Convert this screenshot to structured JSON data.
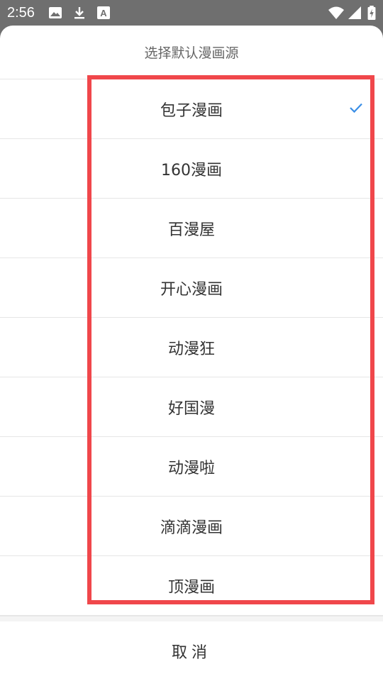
{
  "status_bar": {
    "time": "2:56",
    "left_icons": [
      "image-icon",
      "download-icon",
      "font-icon"
    ],
    "right_icons": [
      "wifi-icon",
      "signal-icon",
      "battery-charging-icon"
    ]
  },
  "dialog": {
    "title": "选择默认漫画源",
    "options": [
      {
        "label": "包子漫画",
        "selected": true
      },
      {
        "label": "160漫画",
        "selected": false
      },
      {
        "label": "百漫屋",
        "selected": false
      },
      {
        "label": "开心漫画",
        "selected": false
      },
      {
        "label": "动漫狂",
        "selected": false
      },
      {
        "label": "好国漫",
        "selected": false
      },
      {
        "label": "动漫啦",
        "selected": false
      },
      {
        "label": "滴滴漫画",
        "selected": false
      },
      {
        "label": "顶漫画",
        "selected": false
      }
    ],
    "cancel_label": "取消"
  },
  "colors": {
    "accent": "#3a8ee6",
    "highlight_border": "#f0474b",
    "status_bar": "#6f6f6f"
  }
}
